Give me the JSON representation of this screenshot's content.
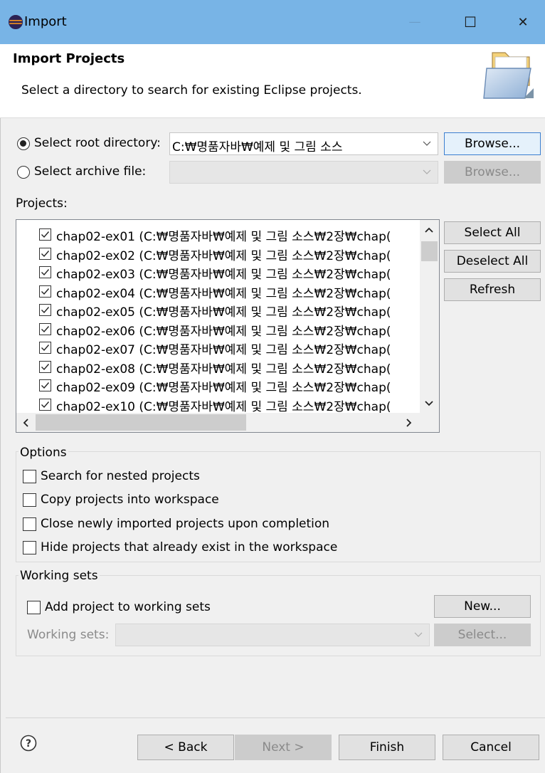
{
  "window": {
    "title": "Import",
    "minimize": "—",
    "maximize": "☐",
    "close": "✕"
  },
  "header": {
    "title": "Import Projects",
    "description": "Select a directory to search for existing Eclipse projects."
  },
  "source": {
    "root_label": "Select root directory:",
    "root_value": "C:₩명품자바₩예제 및 그림 소스",
    "root_selected": true,
    "archive_label": "Select archive file:",
    "archive_value": "",
    "browse_label": "Browse...",
    "browse_disabled_label": "Browse..."
  },
  "projects": {
    "label": "Projects:",
    "items": [
      {
        "label": "chap02-ex01 (C:₩명품자바₩예제 및 그림 소스₩2장₩chap(",
        "checked": true
      },
      {
        "label": "chap02-ex02 (C:₩명품자바₩예제 및 그림 소스₩2장₩chap(",
        "checked": true
      },
      {
        "label": "chap02-ex03 (C:₩명품자바₩예제 및 그림 소스₩2장₩chap(",
        "checked": true
      },
      {
        "label": "chap02-ex04 (C:₩명품자바₩예제 및 그림 소스₩2장₩chap(",
        "checked": true
      },
      {
        "label": "chap02-ex05 (C:₩명품자바₩예제 및 그림 소스₩2장₩chap(",
        "checked": true
      },
      {
        "label": "chap02-ex06 (C:₩명품자바₩예제 및 그림 소스₩2장₩chap(",
        "checked": true
      },
      {
        "label": "chap02-ex07 (C:₩명품자바₩예제 및 그림 소스₩2장₩chap(",
        "checked": true
      },
      {
        "label": "chap02-ex08 (C:₩명품자바₩예제 및 그림 소스₩2장₩chap(",
        "checked": true
      },
      {
        "label": "chap02-ex09 (C:₩명품자바₩예제 및 그림 소스₩2장₩chap(",
        "checked": true
      },
      {
        "label": "chap02-ex10 (C:₩명품자바₩예제 및 그림 소스₩2장₩chap(",
        "checked": true
      }
    ],
    "select_all": "Select All",
    "deselect_all": "Deselect All",
    "refresh": "Refresh"
  },
  "options": {
    "title": "Options",
    "search_nested": "Search for nested projects",
    "copy_projects": "Copy projects into workspace",
    "close_imported": "Close newly imported projects upon completion",
    "hide_existing": "Hide projects that already exist in the workspace"
  },
  "working_sets": {
    "title": "Working sets",
    "add_label": "Add project to working sets",
    "new_button": "New...",
    "sets_label": "Working sets:",
    "sets_value": "",
    "select_button": "Select..."
  },
  "footer": {
    "back": "< Back",
    "next": "Next >",
    "finish": "Finish",
    "cancel": "Cancel"
  },
  "colors": {
    "titlebar": "#78b4e6",
    "accent": "#3c7fd0"
  }
}
